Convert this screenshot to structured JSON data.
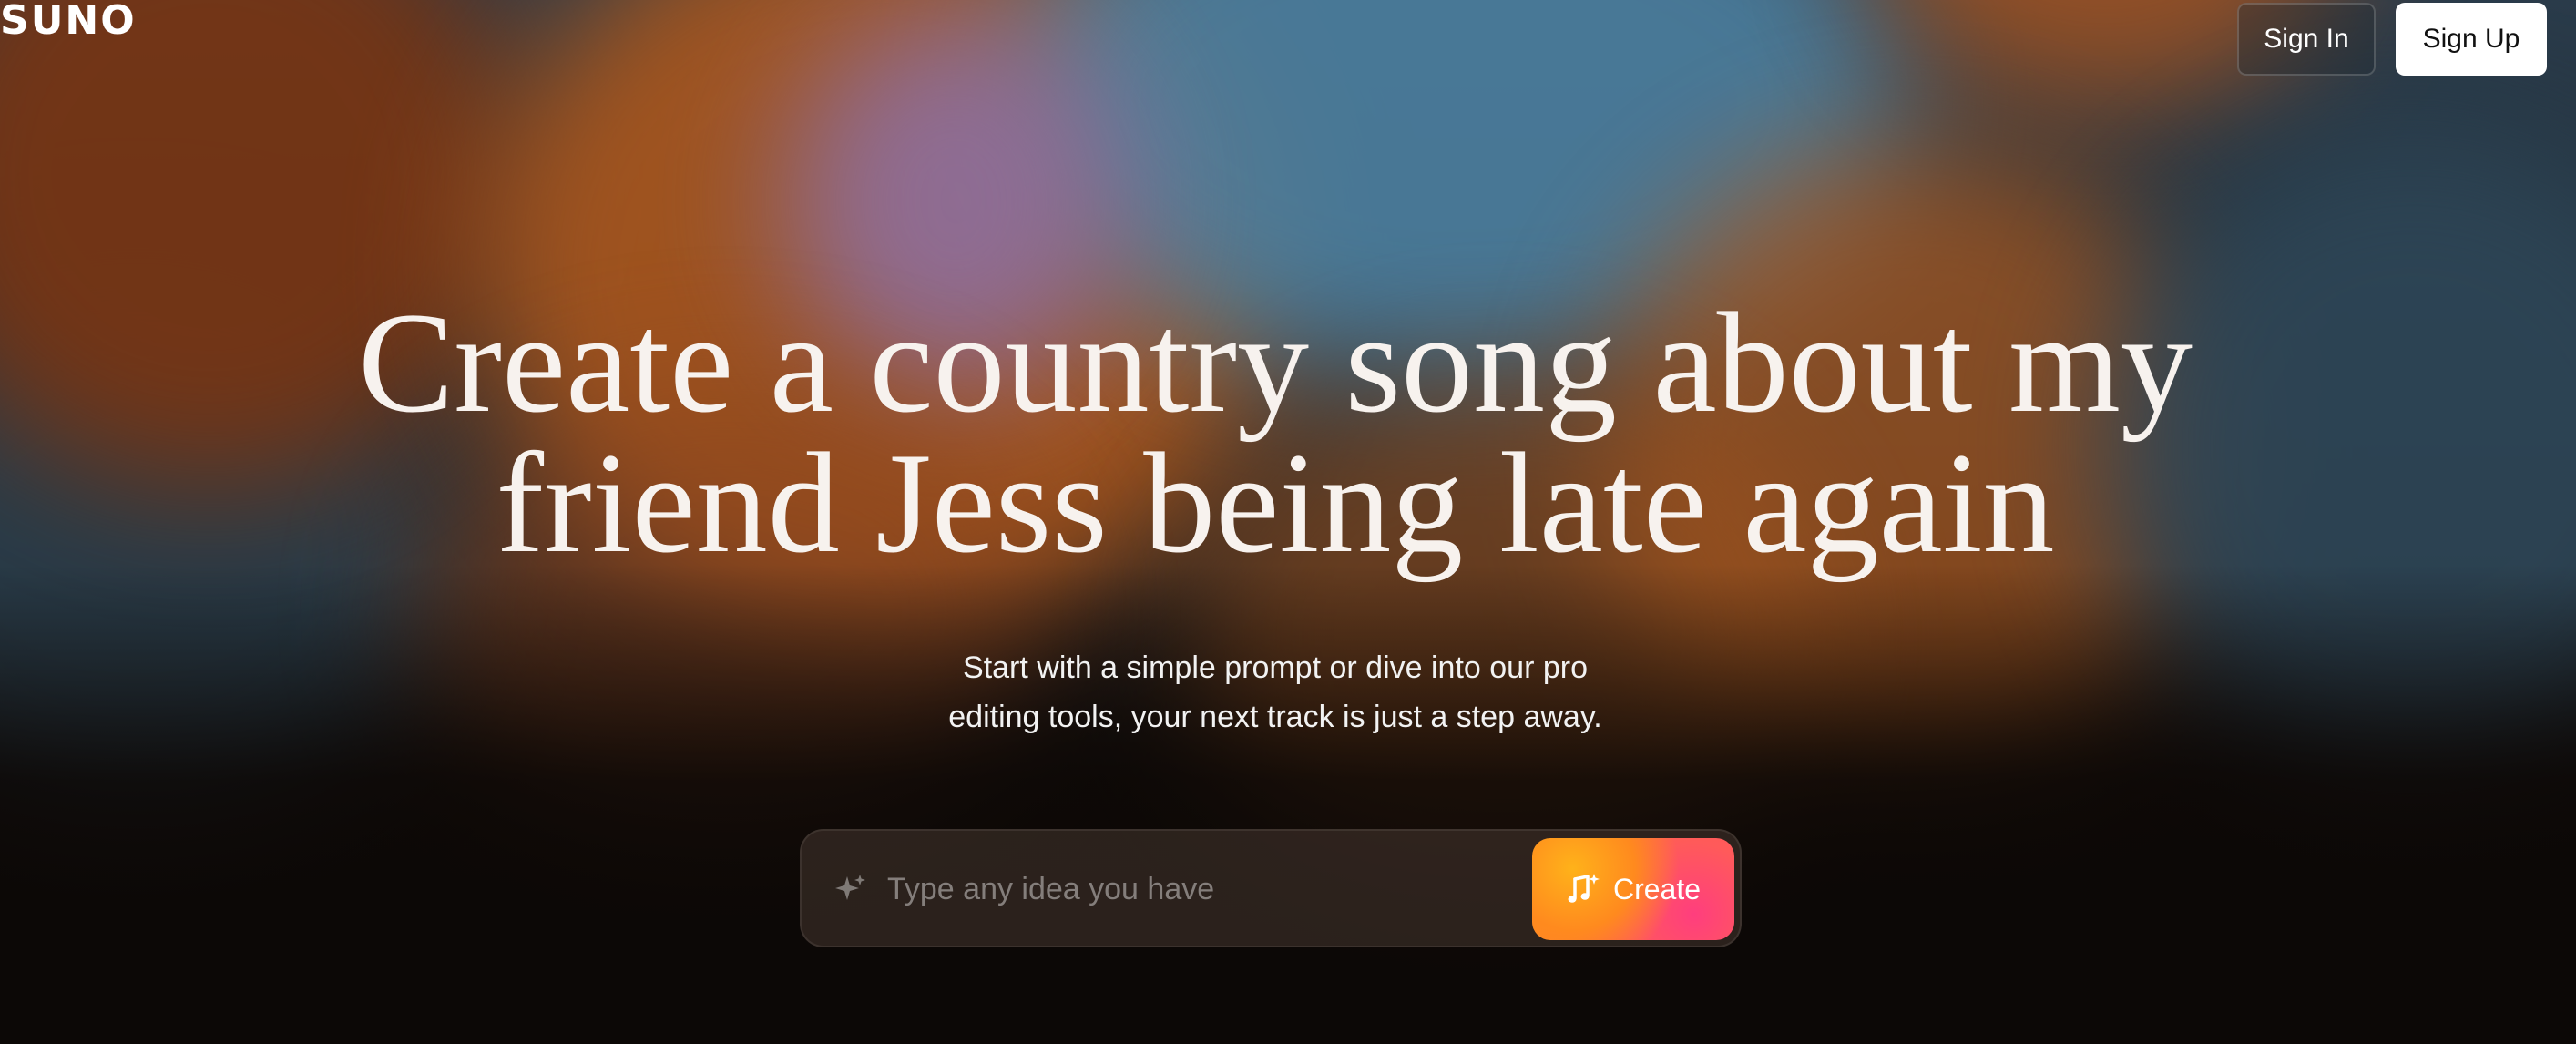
{
  "header": {
    "logo": "SUNO",
    "sign_in_label": "Sign In",
    "sign_up_label": "Sign Up"
  },
  "hero": {
    "headline_line1": "Create a country song about my",
    "headline_line2": "friend Jess being late again",
    "subtext_line1": "Start with a simple prompt or dive into our pro",
    "subtext_line2": "editing tools, your next track is just a step away."
  },
  "prompt": {
    "placeholder": "Type any idea you have",
    "value": "",
    "create_label": "Create",
    "sparkle_icon": "sparkle-icon",
    "create_icon": "music-note-plus-icon"
  },
  "colors": {
    "accent_orange": "#ff9a1a",
    "accent_pink": "#ff3f7a",
    "sign_up_bg": "#ffffff"
  }
}
